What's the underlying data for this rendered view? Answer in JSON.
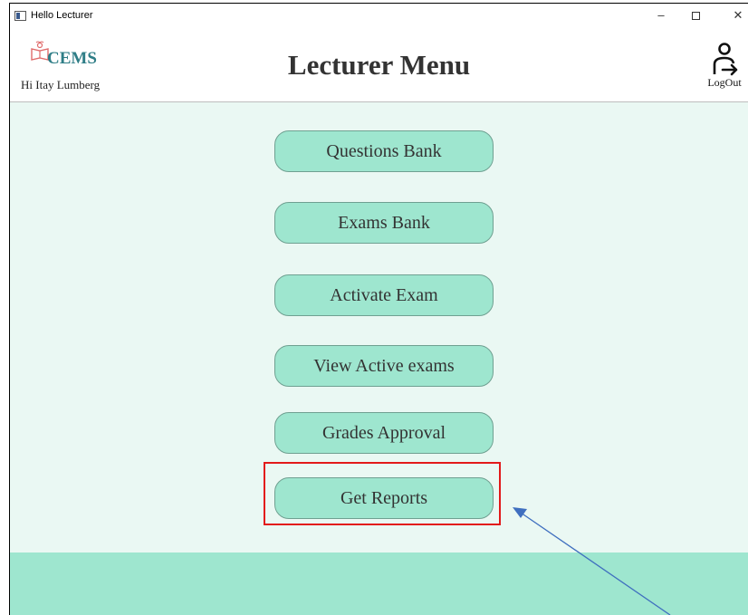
{
  "window": {
    "title": "Hello Lecturer",
    "controls": {
      "minimize": "–",
      "close": "✕"
    }
  },
  "header": {
    "logo_text": "CEMS",
    "greeting": "Hi Itay Lumberg",
    "title": "Lecturer Menu",
    "logout_label": "LogOut"
  },
  "menu": {
    "items": [
      {
        "label": "Questions Bank"
      },
      {
        "label": "Exams Bank"
      },
      {
        "label": "Activate Exam"
      },
      {
        "label": "View Active exams"
      },
      {
        "label": "Grades Approval"
      },
      {
        "label": "Get Reports"
      }
    ]
  },
  "colors": {
    "button_fill": "#9ee6cf",
    "content_background": "#eaf8f3",
    "highlight_box": "#e21a1a",
    "annotation_arrow": "#3f6fbf",
    "logo_text": "#2e7d86"
  }
}
